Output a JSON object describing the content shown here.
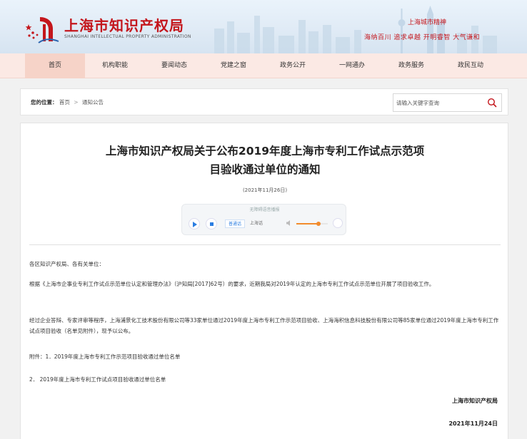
{
  "header": {
    "site_name_cn": "上海市知识产权局",
    "site_name_en": "SHANGHAI INTELLECTUAL PROPERTY ADMINISTRATION",
    "spirit_title": "上海城市精神",
    "spirit_text": "海纳百川  追求卓越  开明睿智  大气谦和"
  },
  "nav": {
    "items": [
      {
        "label": "首页"
      },
      {
        "label": "机构职能"
      },
      {
        "label": "要闻动态"
      },
      {
        "label": "党建之窗"
      },
      {
        "label": "政务公开"
      },
      {
        "label": "一网通办"
      },
      {
        "label": "政务服务"
      },
      {
        "label": "政民互动"
      }
    ]
  },
  "breadcrumb": {
    "prefix": "您的位置：",
    "home": "首页",
    "separator": ">",
    "current": "通知公告"
  },
  "search": {
    "placeholder": "请输入关键字查询"
  },
  "article": {
    "title_line1": "上海市知识产权局关于公布2019年度上海市专利工作试点示范项",
    "title_line2": "目验收通过单位的通知",
    "date": "(2021年11月26日)",
    "player": {
      "label": "无障碍语音播报",
      "lang_normal": "普通话",
      "lang_shanghai": "上海话",
      "volume": 0.7
    },
    "greeting": "各区知识产权局、各有关单位：",
    "para1": "根据《上海市企事业专利工作试点示范单位认定和管理办法》（沪知局[2017]62号）的要求，近期我局对2019年认定的上海市专利工作试点示范单位开展了项目验收工作。",
    "para2": "经过企业答辩、专家评审等程序，上海浦景化工技术股份有限公司等33家单位通过2019年度上海市专利工作示范项目验收、上海海积信息科技股份有限公司等85家单位通过2019年度上海市专利工作试点项目验收（名单见附件），现予以公布。",
    "attach1": "附件：1．2019年度上海市专利工作示范项目验收通过单位名单",
    "attach2": "2．  2019年度上海市专利工作试点项目验收通过单位名单",
    "signature": "上海市知识产权局",
    "sign_date": "2021年11月24日"
  },
  "colors": {
    "brand_red": "#c4161c",
    "nav_bg": "#fbe9e4",
    "nav_active": "#f6d3c8",
    "player_accent": "#2b7de1",
    "volume_accent": "#f28b2c"
  }
}
